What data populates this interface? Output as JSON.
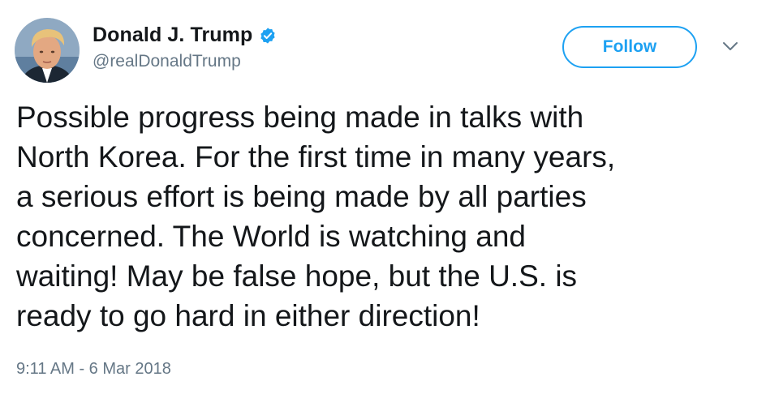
{
  "author": {
    "display_name": "Donald J. Trump",
    "handle": "@realDonaldTrump",
    "verified": true
  },
  "actions": {
    "follow_label": "Follow"
  },
  "tweet": {
    "text": "Possible progress being made in talks with\nNorth Korea. For the first time in many years,\na serious effort is being made by all parties\nconcerned. The World is watching and\nwaiting! May be false hope, but the U.S. is\nready to go hard in either direction!",
    "timestamp": "9:11 AM - 6 Mar 2018"
  },
  "colors": {
    "accent": "#1da1f2",
    "text": "#14171a",
    "secondary_text": "#657786"
  },
  "icons": {
    "verified": "verified-badge-icon",
    "menu": "chevron-down-icon"
  }
}
